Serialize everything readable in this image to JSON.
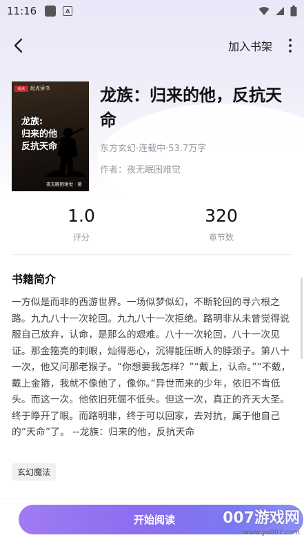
{
  "status": {
    "time": "11:16"
  },
  "topbar": {
    "add_shelf": "加入书架"
  },
  "book": {
    "cover_brand": "起点读书",
    "cover_title": "龙族:\n归来的他\n反抗天命",
    "cover_author": "夜无眠困难觉 · 著",
    "title": "龙族：归来的他，反抗天命",
    "meta": "东方玄幻·连载中·53.7万字",
    "author": "作者：夜无眠困难觉"
  },
  "stats": {
    "rating": {
      "value": "1.0",
      "label": "评分"
    },
    "chapters": {
      "value": "320",
      "label": "章节数"
    }
  },
  "intro": {
    "title": "书籍简介",
    "text": "一方似是而非的西游世界。一场似梦似幻，不断轮回的寻六根之路。九九八十一次轮回。九九八十一次拒绝。路明非从未曾觉得说服自己放弃，认命，是那么的艰难。八十一次轮回，八十一次见证。那金箍亮的刺眼，灿得恶心，沉得能压断人的脖颈子。第八十一次，他又问那老猴子。“你想要我怎样？”“戴上，认命。”“不戴，戴上金箍，我就不像他了，像你。”异世而来的少年，依旧不肯低头。而这一次。他依旧死倔不低头。但这一次，真正的齐天大圣。终于睁开了眼。而路明非，终于可以回家，去对抗，属于他自己的“天命”了。 --龙族：归来的他，反抗天命"
  },
  "tag": "玄幻魔法",
  "start_button": "开始阅读",
  "watermark": {
    "main": "007游戏网",
    "url": "www.yx007.com"
  }
}
